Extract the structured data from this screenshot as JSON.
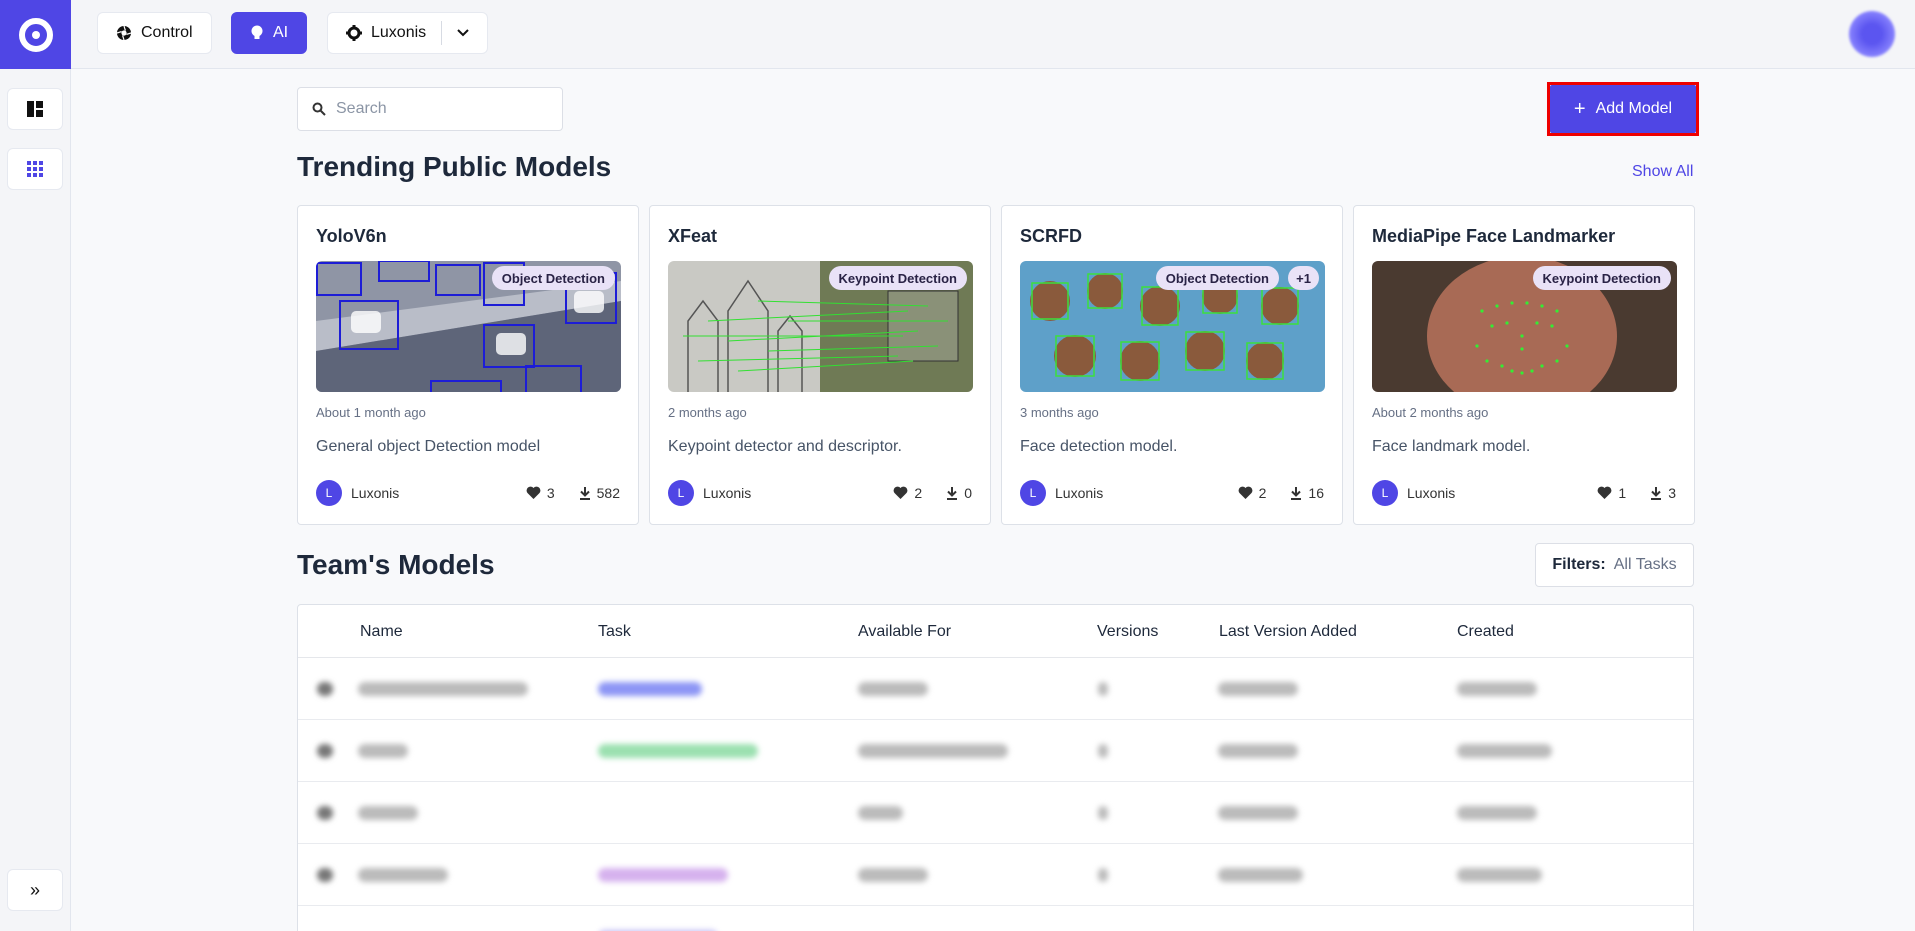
{
  "topbar": {
    "control_label": "Control",
    "ai_label": "AI",
    "org_label": "Luxonis"
  },
  "search": {
    "placeholder": "Search"
  },
  "add_model_label": "Add Model",
  "trending": {
    "title": "Trending Public Models",
    "show_all": "Show All",
    "cards": [
      {
        "title": "YoloV6n",
        "badge": "Object Detection",
        "extra_badge": "",
        "time": "About 1 month ago",
        "description": "General object Detection model",
        "owner": "Luxonis",
        "owner_initial": "L",
        "likes": "3",
        "downloads": "582"
      },
      {
        "title": "XFeat",
        "badge": "Keypoint Detection",
        "extra_badge": "",
        "time": "2 months ago",
        "description": "Keypoint detector and descriptor.",
        "owner": "Luxonis",
        "owner_initial": "L",
        "likes": "2",
        "downloads": "0"
      },
      {
        "title": "SCRFD",
        "badge": "Object Detection",
        "extra_badge": "+1",
        "time": "3 months ago",
        "description": "Face detection model.",
        "owner": "Luxonis",
        "owner_initial": "L",
        "likes": "2",
        "downloads": "16"
      },
      {
        "title": "MediaPipe Face Landmarker",
        "badge": "Keypoint Detection",
        "extra_badge": "",
        "time": "About 2 months ago",
        "description": "Face landmark model.",
        "owner": "Luxonis",
        "owner_initial": "L",
        "likes": "1",
        "downloads": "3"
      }
    ]
  },
  "team": {
    "title": "Team's Models",
    "filters_label": "Filters:",
    "filters_value": "All Tasks",
    "columns": [
      "Name",
      "Task",
      "Available For",
      "Versions",
      "Last Version Added",
      "Created"
    ]
  },
  "colors": {
    "accent": "#4f46e5",
    "highlight": "#e00000"
  },
  "icons": [
    "logo-icon",
    "dashboard-icon",
    "apps-grid-icon",
    "expand-icon",
    "aperture-icon",
    "bulb-icon",
    "gear-icon",
    "chevron-down-icon",
    "search-icon",
    "plus-icon",
    "heart-icon",
    "download-icon"
  ]
}
